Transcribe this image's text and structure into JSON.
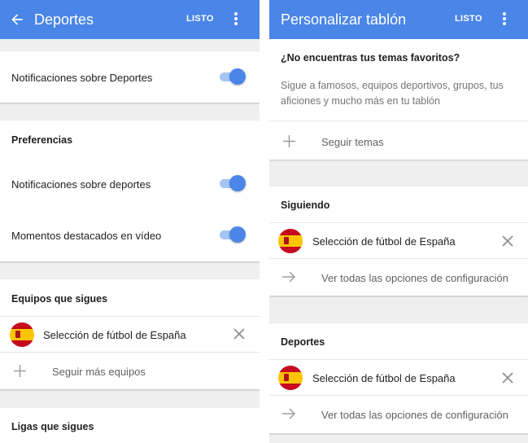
{
  "left": {
    "header": {
      "title": "Deportes",
      "done_label": "LISTO"
    },
    "notifications_card": {
      "label": "Notificaciones sobre Deportes",
      "toggle_on": true
    },
    "preferences_card": {
      "title": "Preferencias",
      "items": [
        {
          "label": "Notificaciones sobre deportes",
          "toggle_on": true
        },
        {
          "label": "Momentos destacados en vídeo",
          "toggle_on": true
        }
      ]
    },
    "teams_card": {
      "title": "Equipos que sigues",
      "team": "Selección de fútbol de España",
      "follow_more_label": "Seguir más equipos"
    },
    "leagues_card": {
      "title": "Ligas que sigues"
    }
  },
  "right": {
    "header": {
      "title": "Personalizar tablón",
      "done_label": "LISTO"
    },
    "favorites_card": {
      "title": "¿No encuentras tus temas favoritos?",
      "description": "Sigue a famosos, equipos deportivos, grupos, tus aficiones y mucho más en tu tablón",
      "follow_topics_label": "Seguir temas"
    },
    "following_card": {
      "title": "Siguiendo",
      "team": "Selección de fútbol de España",
      "view_all_label": "Ver todas las opciones de configuración"
    },
    "sports_card": {
      "title": "Deportes",
      "team": "Selección de fútbol de España",
      "view_all_label": "Ver todas las opciones de configuración"
    }
  },
  "colors": {
    "accent": "#4a86e8",
    "toggle_track": "#a6c4f4",
    "background": "#efefef"
  },
  "icons": [
    "back-arrow-icon",
    "more-vert-icon",
    "spain-flag-icon",
    "close-icon",
    "plus-icon",
    "arrow-right-icon"
  ]
}
